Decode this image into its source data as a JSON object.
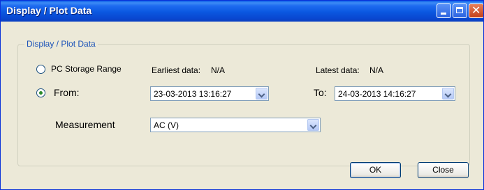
{
  "window": {
    "title": "Display / Plot Data"
  },
  "group": {
    "legend": "Display / Plot Data"
  },
  "pc_storage": {
    "label": "PC Storage Range",
    "checked": false
  },
  "earliest": {
    "label": "Earliest data:",
    "value": "N/A"
  },
  "latest": {
    "label": "Latest data:",
    "value": "N/A"
  },
  "from": {
    "label": "From:",
    "checked": true,
    "value": "23-03-2013 13:16:27"
  },
  "to": {
    "label": "To:",
    "value": "24-03-2013 14:16:27"
  },
  "measurement": {
    "label": "Measurement",
    "value": "AC (V)"
  },
  "buttons": {
    "ok": "OK",
    "close": "Close"
  },
  "icons": {
    "minimize": "minimize-icon",
    "maximize": "maximize-icon",
    "close": "close-icon",
    "dropdown": "chevron-down-icon"
  },
  "colors": {
    "titlebar": "#0a57e0",
    "legend_text": "#1a52b8",
    "radio_dot": "#2a8a2a",
    "close_button": "#c4401a"
  }
}
